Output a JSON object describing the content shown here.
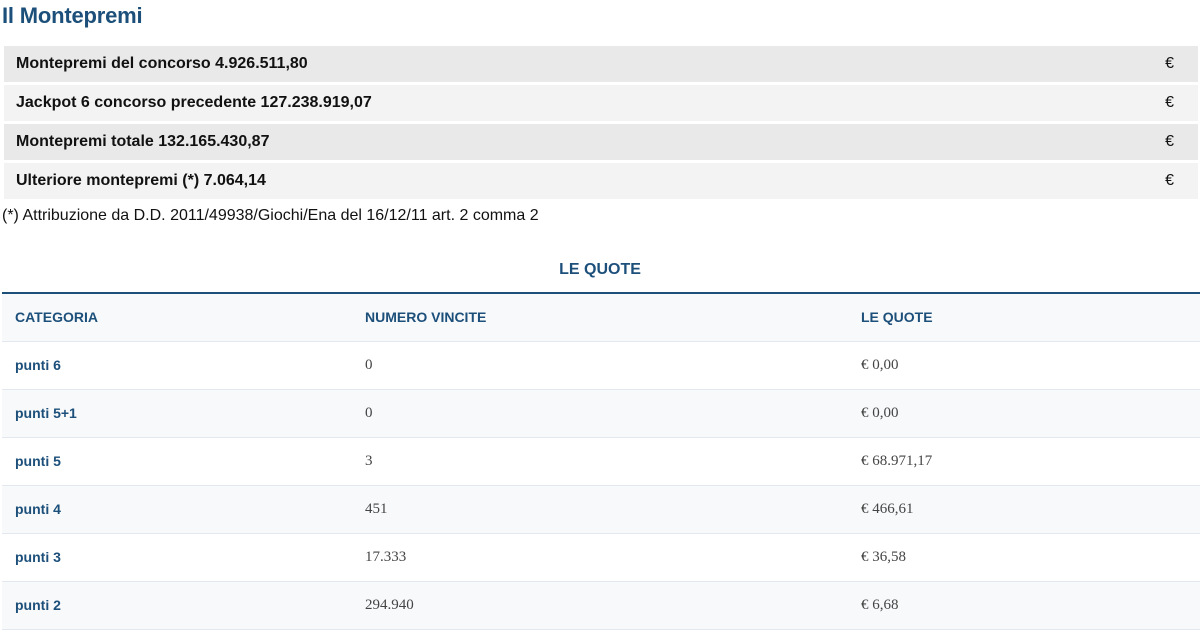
{
  "page_title": "Il Montepremi",
  "summary": [
    {
      "label": "Montepremi del concorso",
      "value": "4.926.511,80",
      "currency": "€"
    },
    {
      "label": "Jackpot 6 concorso precedente",
      "value": "127.238.919,07",
      "currency": "€"
    },
    {
      "label": "Montepremi totale",
      "value": "132.165.430,87",
      "currency": "€"
    },
    {
      "label": "Ulteriore montepremi (*)",
      "value": "7.064,14",
      "currency": "€"
    }
  ],
  "footnote": "(*) Attribuzione da D.D. 2011/49938/Giochi/Ena del 16/12/11 art. 2 comma 2",
  "quotes": {
    "title": "LE QUOTE",
    "headers": [
      "CATEGORIA",
      "NUMERO VINCITE",
      "LE QUOTE"
    ],
    "rows": [
      {
        "category": "punti 6",
        "wins": "0",
        "amount": "€ 0,00"
      },
      {
        "category": "punti 5+1",
        "wins": "0",
        "amount": "€ 0,00"
      },
      {
        "category": "punti 5",
        "wins": "3",
        "amount": "€ 68.971,17"
      },
      {
        "category": "punti 4",
        "wins": "451",
        "amount": "€ 466,61"
      },
      {
        "category": "punti 3",
        "wins": "17.333",
        "amount": "€ 36,58"
      },
      {
        "category": "punti 2",
        "wins": "294.940",
        "amount": "€ 6,68"
      }
    ]
  }
}
